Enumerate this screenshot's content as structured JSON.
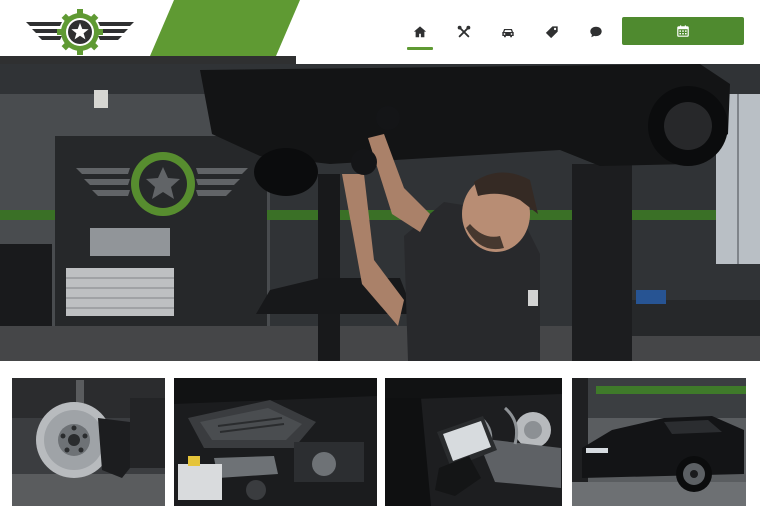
{
  "header": {
    "logo": {
      "icon": "star-gear-wings-logo",
      "brand_green": "#5f9a33",
      "dark": "#2f3031"
    },
    "nav": [
      {
        "icon": "home-icon",
        "active": true
      },
      {
        "icon": "tools-icon",
        "active": false
      },
      {
        "icon": "car-icon",
        "active": false
      },
      {
        "icon": "tag-icon",
        "active": false
      },
      {
        "icon": "chat-bubble-icon",
        "active": false
      }
    ],
    "cta": {
      "icon": "calendar-icon",
      "color": "#4f8a2f"
    }
  },
  "hero": {
    "image": "mechanic-working-under-lifted-car"
  },
  "gallery": [
    {
      "image": "brake-disc-and-caliper"
    },
    {
      "image": "car-engine-bay"
    },
    {
      "image": "engine-diagnostic-tablet"
    },
    {
      "image": "black-sports-car-in-garage"
    }
  ]
}
